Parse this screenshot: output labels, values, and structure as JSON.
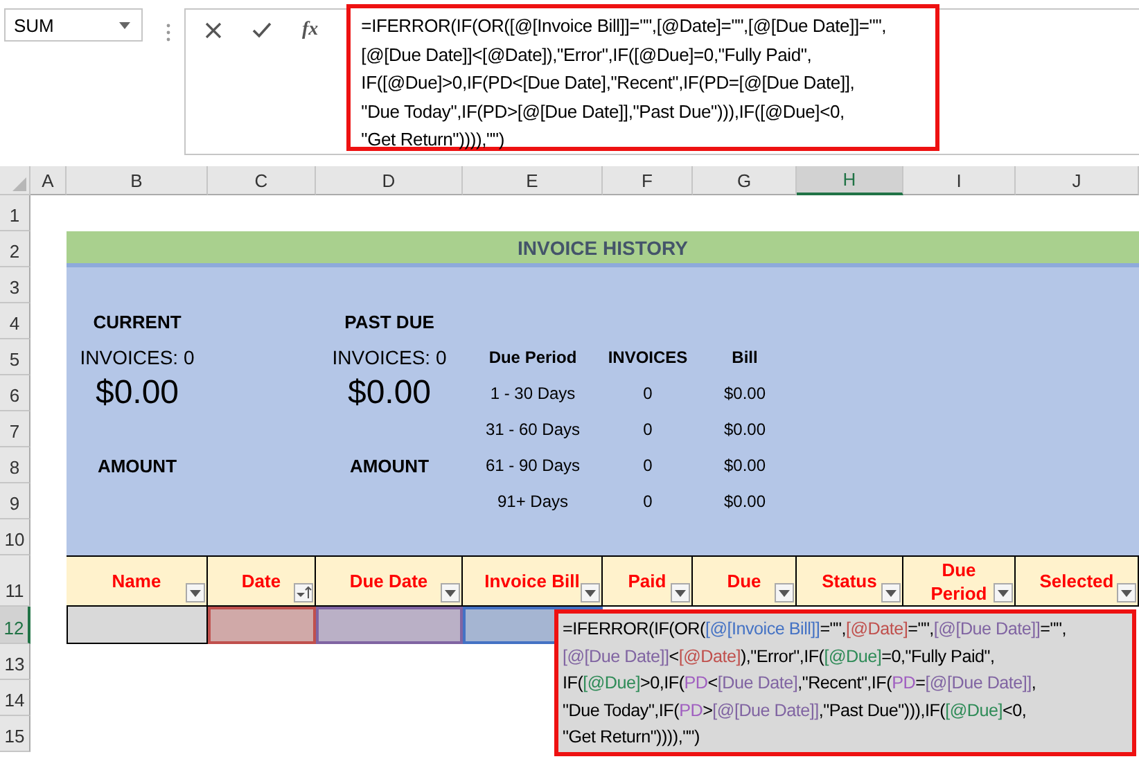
{
  "name_box": {
    "value": "SUM"
  },
  "formula_bar": {
    "function_label": "fx",
    "lines": [
      "=IFERROR(IF(OR([@[Invoice Bill]]=\"\",[@Date]=\"\",[@[Due Date]]=\"\",",
      "[@[Due Date]]<[@Date]),\"Error\",IF([@Due]=0,\"Fully Paid\",",
      "IF([@Due]>0,IF(PD<[Due Date],\"Recent\",IF(PD=[@[Due Date]],",
      "\"Due Today\",IF(PD>[@[Due Date]],\"Past Due\"))),IF([@Due]<0,",
      "\"Get Return\")))),\"\")"
    ]
  },
  "column_headers": [
    {
      "label": "A",
      "selected": false
    },
    {
      "label": "B",
      "selected": false
    },
    {
      "label": "C",
      "selected": false
    },
    {
      "label": "D",
      "selected": false
    },
    {
      "label": "E",
      "selected": false
    },
    {
      "label": "F",
      "selected": false
    },
    {
      "label": "G",
      "selected": false
    },
    {
      "label": "H",
      "selected": true
    },
    {
      "label": "I",
      "selected": false
    },
    {
      "label": "J",
      "selected": false
    }
  ],
  "row_headers": [
    {
      "label": "1",
      "selected": false
    },
    {
      "label": "2",
      "selected": false
    },
    {
      "label": "3",
      "selected": false
    },
    {
      "label": "4",
      "selected": false
    },
    {
      "label": "5",
      "selected": false
    },
    {
      "label": "6",
      "selected": false
    },
    {
      "label": "7",
      "selected": false
    },
    {
      "label": "8",
      "selected": false
    },
    {
      "label": "9",
      "selected": false
    },
    {
      "label": "10",
      "selected": false
    },
    {
      "label": "11",
      "selected": false
    },
    {
      "label": "12",
      "selected": true
    },
    {
      "label": "13",
      "selected": false
    },
    {
      "label": "14",
      "selected": false
    },
    {
      "label": "15",
      "selected": false
    }
  ],
  "title": "INVOICE HISTORY",
  "summaries": [
    {
      "heading": "CURRENT",
      "invoices": "INVOICES: 0",
      "amount": "$0.00",
      "label": "AMOUNT"
    },
    {
      "heading": "PAST DUE",
      "invoices": "INVOICES: 0",
      "amount": "$0.00",
      "label": "AMOUNT"
    }
  ],
  "due_table": {
    "columns": [
      "Due Period",
      "INVOICES",
      "Bill"
    ],
    "rows": [
      [
        "1 - 30 Days",
        "0",
        "$0.00"
      ],
      [
        "31 - 60 Days",
        "0",
        "$0.00"
      ],
      [
        "61 - 90 Days",
        "0",
        "$0.00"
      ],
      [
        "91+ Days",
        "0",
        "$0.00"
      ]
    ]
  },
  "table_headers": [
    {
      "label": "Name",
      "kind": "filter"
    },
    {
      "label": "Date",
      "kind": "sorted"
    },
    {
      "label": "Due Date",
      "kind": "filter"
    },
    {
      "label": "Invoice Bill",
      "kind": "filter"
    },
    {
      "label": "Paid",
      "kind": "filter"
    },
    {
      "label": "Due",
      "kind": "filter"
    },
    {
      "label": "Status",
      "kind": "filter"
    },
    {
      "label": "Due Period",
      "kind": "filter"
    },
    {
      "label": "Selected",
      "kind": "filter"
    }
  ],
  "reference_highlights": [
    {
      "color": "#c0504d"
    },
    {
      "color": "#8064a2"
    },
    {
      "color": "#4472c4"
    }
  ],
  "cell_formula": {
    "lines": [
      [
        {
          "text": "=IFERROR(IF(OR(",
          "color": "#000000"
        },
        {
          "text": "[@[Invoice Bill]]",
          "color": "#4472c4"
        },
        {
          "text": "=\"\",",
          "color": "#000000"
        },
        {
          "text": "[@Date]",
          "color": "#c0504d"
        },
        {
          "text": "=\"\",",
          "color": "#000000"
        },
        {
          "text": "[@[Due Date]]",
          "color": "#8064a2"
        },
        {
          "text": "=\"\",",
          "color": "#000000"
        }
      ],
      [
        {
          "text": "[@[Due Date]]",
          "color": "#8064a2"
        },
        {
          "text": "<",
          "color": "#000000"
        },
        {
          "text": "[@Date]",
          "color": "#c0504d"
        },
        {
          "text": "),\"Error\",IF(",
          "color": "#000000"
        },
        {
          "text": "[@Due]",
          "color": "#2e8b57"
        },
        {
          "text": "=0,\"Fully Paid\",",
          "color": "#000000"
        }
      ],
      [
        {
          "text": "IF(",
          "color": "#000000"
        },
        {
          "text": "[@Due]",
          "color": "#2e8b57"
        },
        {
          "text": ">0,IF(",
          "color": "#000000"
        },
        {
          "text": "PD",
          "color": "#a05fc0"
        },
        {
          "text": "<",
          "color": "#000000"
        },
        {
          "text": "[Due Date]",
          "color": "#8064a2"
        },
        {
          "text": ",\"Recent\",IF(",
          "color": "#000000"
        },
        {
          "text": "PD",
          "color": "#a05fc0"
        },
        {
          "text": "=",
          "color": "#000000"
        },
        {
          "text": "[@[Due Date]]",
          "color": "#8064a2"
        },
        {
          "text": ",",
          "color": "#000000"
        }
      ],
      [
        {
          "text": "\"Due Today\",IF(",
          "color": "#000000"
        },
        {
          "text": "PD",
          "color": "#a05fc0"
        },
        {
          "text": ">",
          "color": "#000000"
        },
        {
          "text": "[@[Due Date]]",
          "color": "#8064a2"
        },
        {
          "text": ",\"Past Due\"))),IF(",
          "color": "#000000"
        },
        {
          "text": "[@Due]",
          "color": "#2e8b57"
        },
        {
          "text": "<0,",
          "color": "#000000"
        }
      ],
      [
        {
          "text": "\"Get Return\")))),\"\")",
          "color": "#000000"
        }
      ]
    ]
  }
}
